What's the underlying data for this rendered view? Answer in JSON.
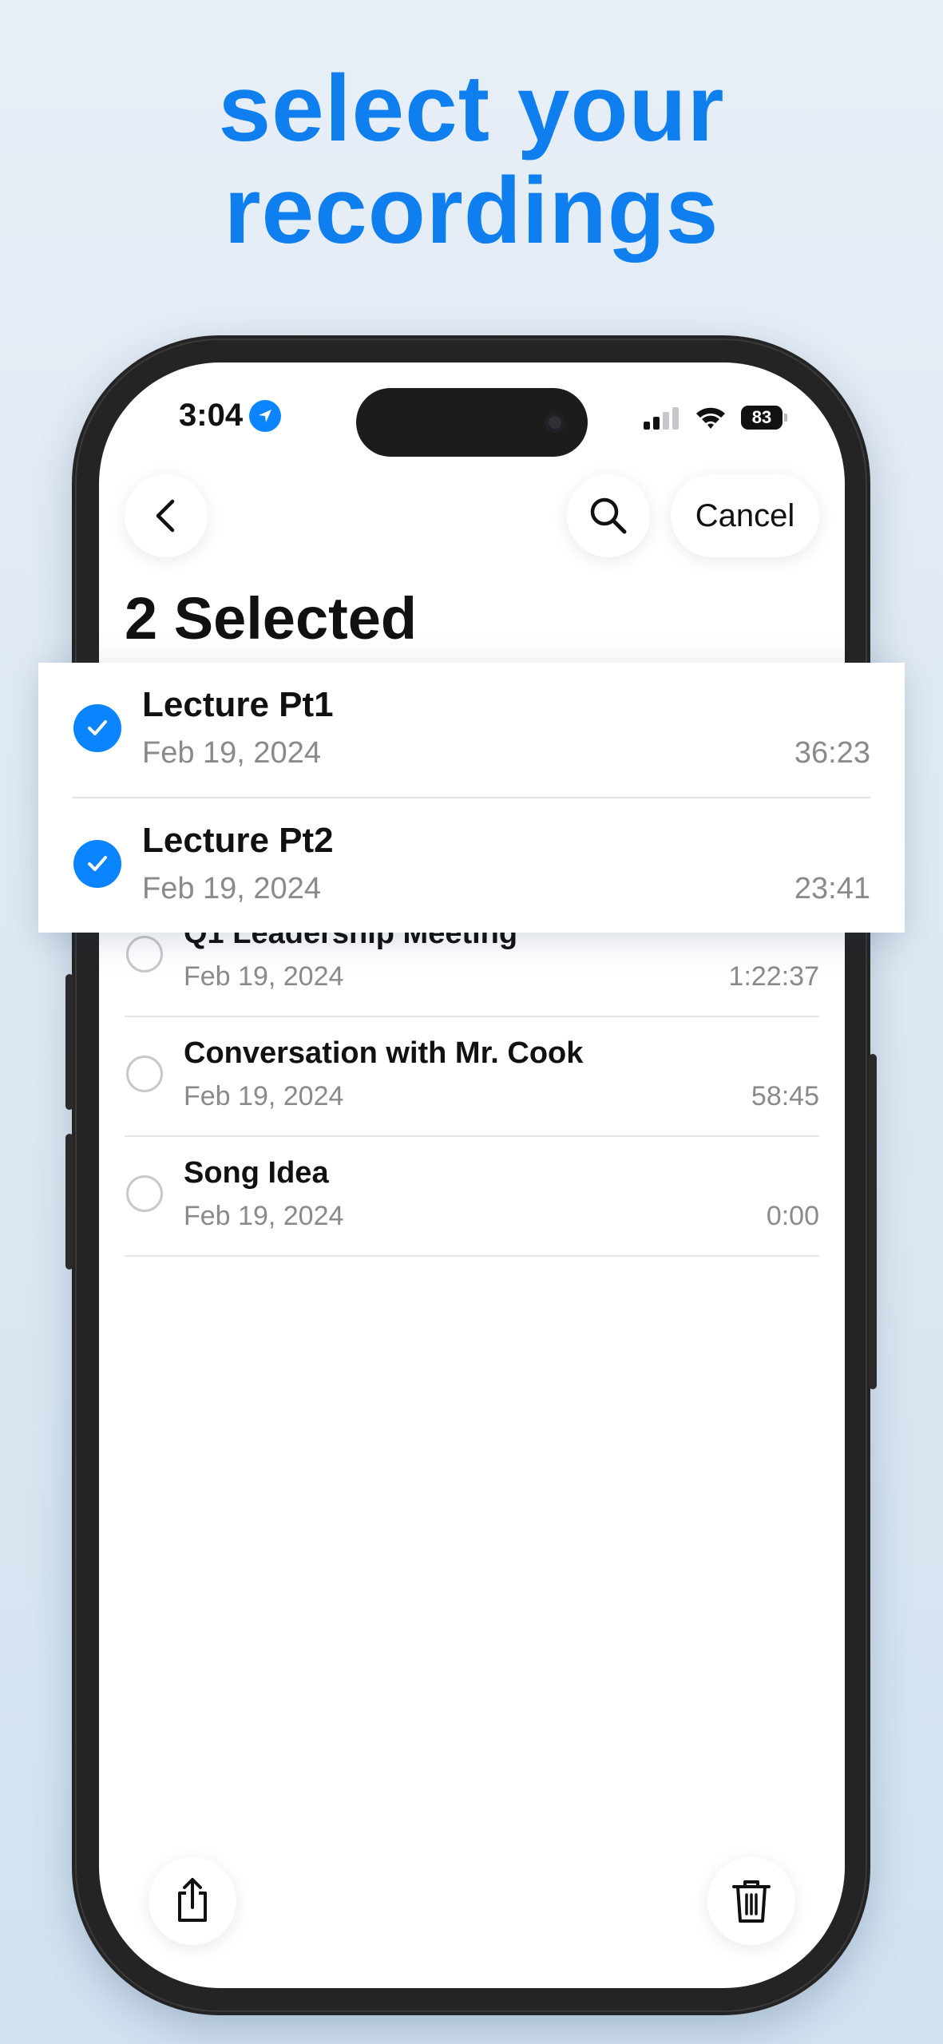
{
  "headline": {
    "line1": "select your",
    "line2": "recordings"
  },
  "status_bar": {
    "time": "3:04",
    "battery": "83"
  },
  "nav": {
    "cancel_label": "Cancel"
  },
  "page_title": "2 Selected",
  "selected_recordings": [
    {
      "title": "Lecture Pt1",
      "date": "Feb 19, 2024",
      "duration": "36:23",
      "selected": true
    },
    {
      "title": "Lecture Pt2",
      "date": "Feb 19, 2024",
      "duration": "23:41",
      "selected": true
    }
  ],
  "recordings": [
    {
      "title": "Q1 Leadership Meeting",
      "date": "Feb 19, 2024",
      "duration": "1:22:37",
      "selected": false
    },
    {
      "title": "Conversation with Mr. Cook",
      "date": "Feb 19, 2024",
      "duration": "58:45",
      "selected": false
    },
    {
      "title": "Song Idea",
      "date": "Feb 19, 2024",
      "duration": "0:00",
      "selected": false
    }
  ],
  "colors": {
    "accent": "#0a84ff",
    "headline": "#0f7ff0"
  }
}
